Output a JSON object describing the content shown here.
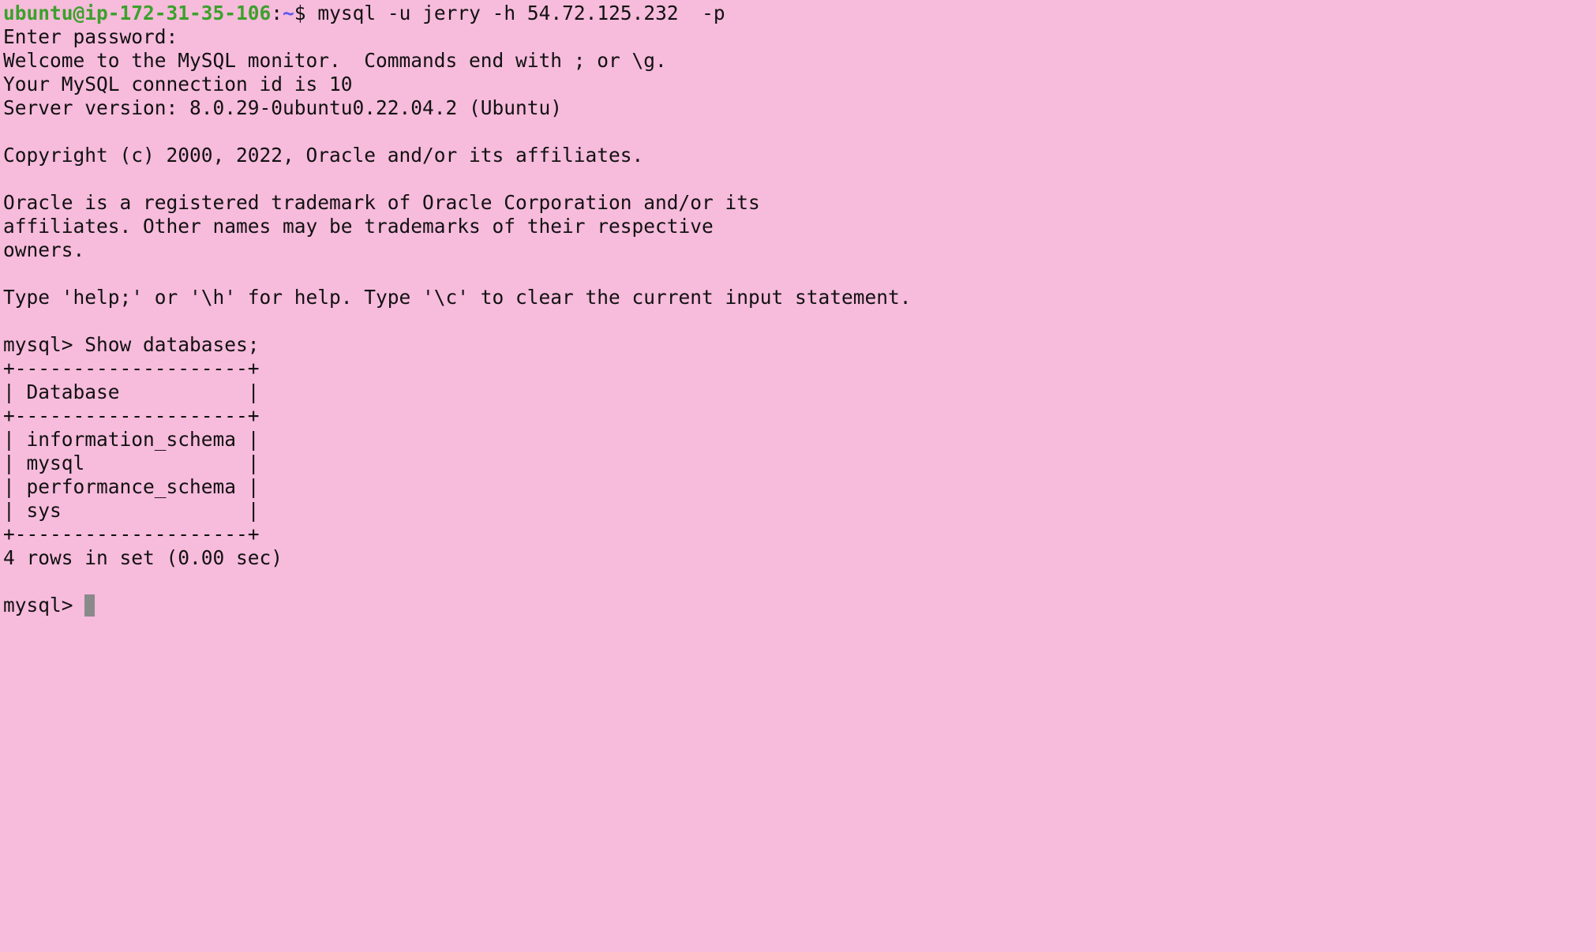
{
  "terminal": {
    "background_color": "#f7bbdc",
    "prompt_user_host_color": "#3ba12b",
    "prompt_path_color": "#5a56f0",
    "cursor_color": "#8a8a8a",
    "first_prompt": {
      "user_host": "ubuntu@ip-172-31-35-106",
      "separator": ":",
      "path": "~",
      "symbol": "$",
      "command": " mysql -u jerry -h 54.72.125.232  -p"
    },
    "lines": [
      "Enter password:",
      "Welcome to the MySQL monitor.  Commands end with ; or \\g.",
      "Your MySQL connection id is 10",
      "Server version: 8.0.29-0ubuntu0.22.04.2 (Ubuntu)",
      "",
      "Copyright (c) 2000, 2022, Oracle and/or its affiliates.",
      "",
      "Oracle is a registered trademark of Oracle Corporation and/or its",
      "affiliates. Other names may be trademarks of their respective",
      "owners.",
      "",
      "Type 'help;' or '\\h' for help. Type '\\c' to clear the current input statement.",
      "",
      "mysql> Show databases;",
      "+--------------------+",
      "| Database           |",
      "+--------------------+",
      "| information_schema |",
      "| mysql              |",
      "| performance_schema |",
      "| sys                |",
      "+--------------------+",
      "4 rows in set (0.00 sec)",
      ""
    ],
    "current_prompt": "mysql> "
  }
}
